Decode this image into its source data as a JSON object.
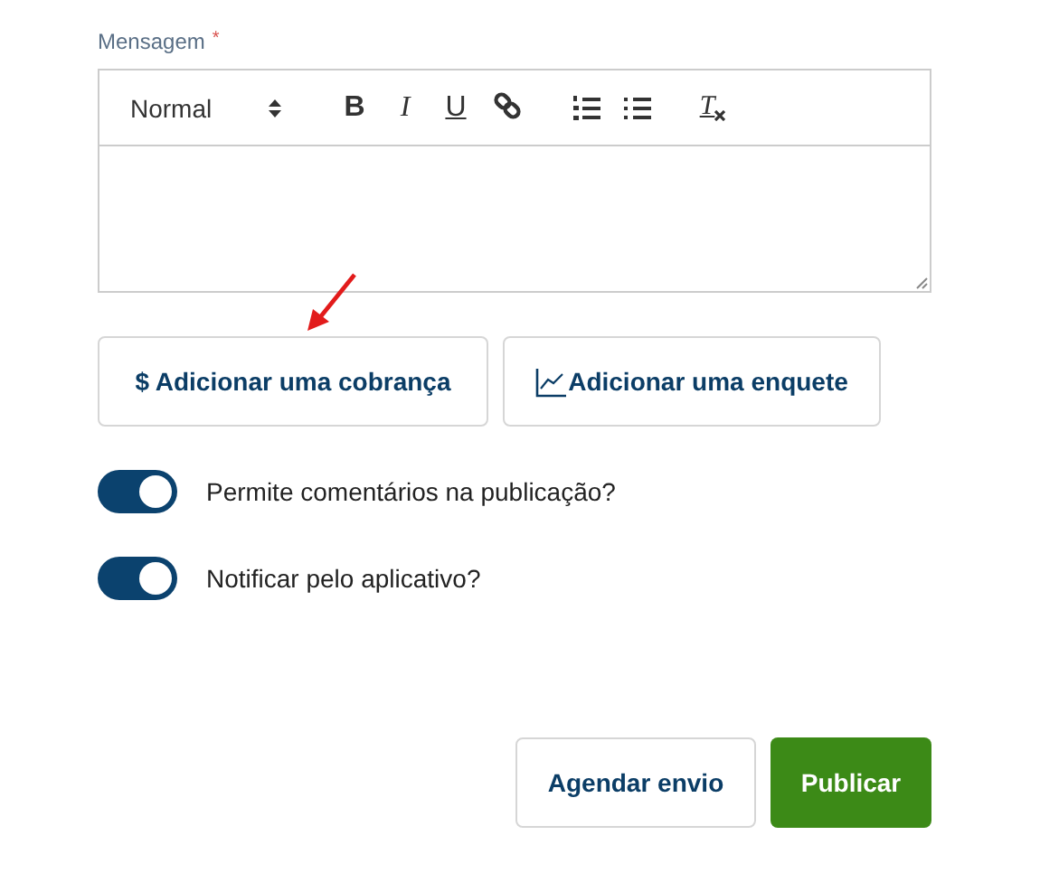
{
  "message_field": {
    "label": "Mensagem",
    "required_mark": "*",
    "toolbar": [
      {
        "kind": "select",
        "label": "Normal"
      },
      {
        "kind": "bold",
        "glyph": "B"
      },
      {
        "kind": "italic",
        "glyph": "I"
      },
      {
        "kind": "underline",
        "glyph": "U"
      },
      {
        "kind": "link"
      },
      {
        "kind": "ordered-list"
      },
      {
        "kind": "bullet-list"
      },
      {
        "kind": "clean",
        "glyph": "T"
      }
    ]
  },
  "attach_buttons": [
    {
      "kind": "charge",
      "label": "$ Adicionar uma cobrança"
    },
    {
      "kind": "poll",
      "label": "Adicionar uma enquete"
    }
  ],
  "toggles": [
    {
      "label": "Permite comentários na publicação?",
      "on": true
    },
    {
      "label": "Notificar pelo aplicativo?",
      "on": true
    }
  ],
  "actions": [
    {
      "kind": "secondary",
      "label": "Agendar envio"
    },
    {
      "kind": "primary",
      "label": "Publicar"
    }
  ]
}
